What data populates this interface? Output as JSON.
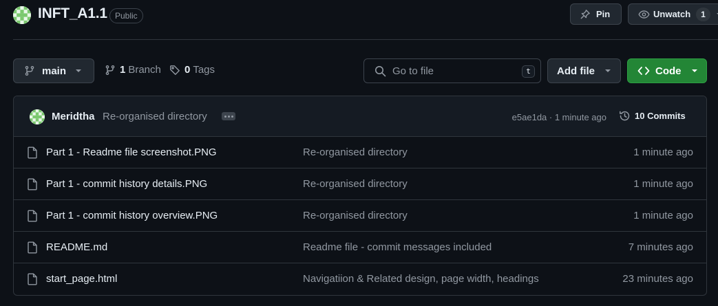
{
  "repo": {
    "name": "INFT_A1.1",
    "visibility": "Public"
  },
  "actions": {
    "pin_label": "Pin",
    "watch_label": "Unwatch",
    "watch_count": "1"
  },
  "toolbar": {
    "branch": "main",
    "branch_count": "1",
    "branch_label": "Branch",
    "tag_count": "0",
    "tag_label": "Tags",
    "search_placeholder": "Go to file",
    "search_shortcut": "t",
    "add_file_label": "Add file",
    "code_label": "Code"
  },
  "latest_commit": {
    "author": "Meridtha",
    "message": "Re-organised directory",
    "hash_time": "e5ae1da · 1 minute ago",
    "commits_label": "10 Commits"
  },
  "files": [
    {
      "name": "Part 1 - Readme file screenshot.PNG",
      "commit": "Re-organised directory",
      "age": "1 minute ago"
    },
    {
      "name": "Part 1 - commit history details.PNG",
      "commit": "Re-organised directory",
      "age": "1 minute ago"
    },
    {
      "name": "Part 1 - commit history overview.PNG",
      "commit": "Re-organised directory",
      "age": "1 minute ago"
    },
    {
      "name": "README.md",
      "commit": "Readme file - commit messages included",
      "age": "7 minutes ago"
    },
    {
      "name": "start_page.html",
      "commit": "Navigatiion & Related design, page width, headings",
      "age": "23 minutes ago"
    }
  ],
  "colors": {
    "background": "#0d1117",
    "accent_green": "#238636",
    "muted_text": "#9198a1"
  }
}
